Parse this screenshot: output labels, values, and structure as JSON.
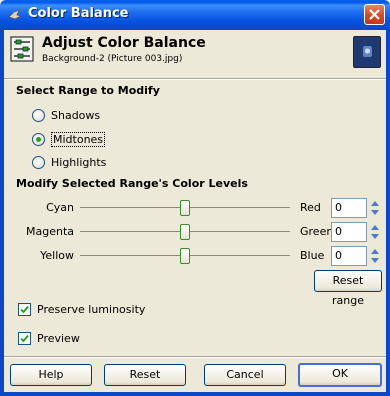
{
  "window": {
    "title": "Color Balance",
    "title_icon": "gimp-icon",
    "close_icon": "close-icon"
  },
  "header": {
    "title": "Adjust Color Balance",
    "subtitle": "Background-2 (Picture 003.jpg)"
  },
  "range": {
    "section_label": "Select Range to Modify",
    "options": [
      {
        "label": "Shadows",
        "checked": false
      },
      {
        "label": "Midtones",
        "checked": true
      },
      {
        "label": "Highlights",
        "checked": false
      }
    ]
  },
  "levels": {
    "section_label": "Modify Selected Range's Color Levels",
    "sliders": [
      {
        "left_label": "Cyan",
        "right_label": "Red",
        "value": "0"
      },
      {
        "left_label": "Magenta",
        "right_label": "Green",
        "value": "0"
      },
      {
        "left_label": "Yellow",
        "right_label": "Blue",
        "value": "0"
      }
    ],
    "reset_range_label": "Reset range"
  },
  "options": {
    "preserve_luminosity": {
      "label": "Preserve luminosity",
      "checked": true
    },
    "preview": {
      "label": "Preview",
      "checked": true
    }
  },
  "buttons": {
    "help": "Help",
    "reset": "Reset",
    "cancel": "Cancel",
    "ok": "OK"
  },
  "colors": {
    "titlebar": "#0a5fe6",
    "background": "#ece9d8",
    "radio_checked": "#21a121"
  }
}
